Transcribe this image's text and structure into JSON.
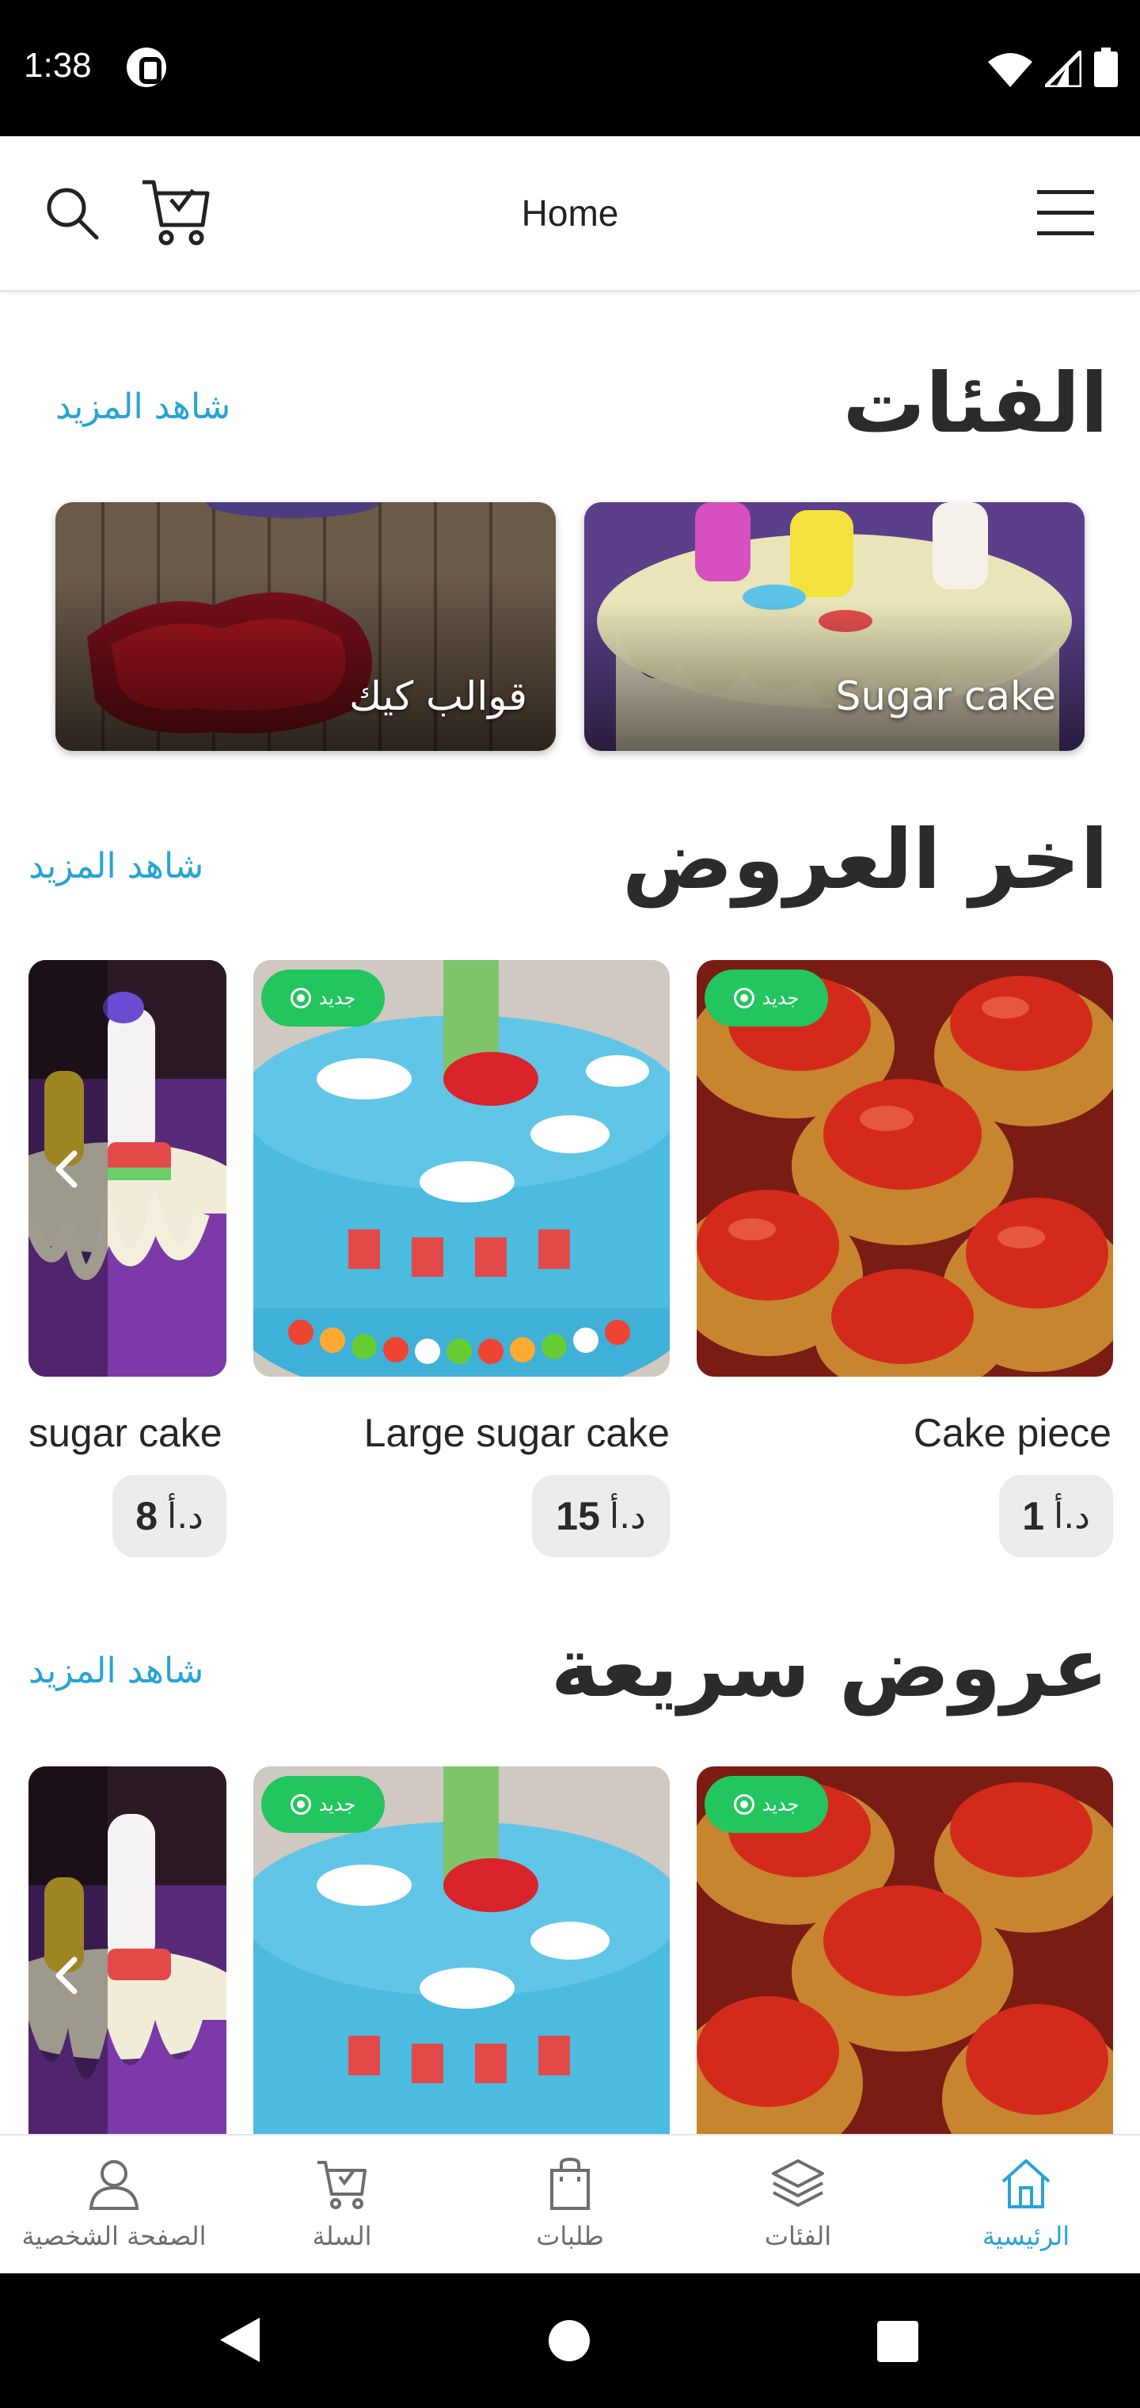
{
  "status_bar": {
    "time": "1:38"
  },
  "app_bar": {
    "title": "Home"
  },
  "categories_section": {
    "title": "الفئات",
    "see_more": "شاهد المزيد",
    "items": [
      {
        "label": "Sugar cake"
      },
      {
        "label": "قوالب كيك"
      }
    ]
  },
  "latest_offers": {
    "title": "اخر العروض",
    "see_more": "شاهد المزيد",
    "badge": "جديد",
    "products": [
      {
        "name": "Cake piece",
        "price": "1",
        "currency": "د.أ"
      },
      {
        "name": "Large sugar cake",
        "price": "15",
        "currency": "د.أ"
      },
      {
        "name": "sugar cake",
        "price": "8",
        "currency": "د.أ"
      }
    ]
  },
  "quick_offers": {
    "title": "عروض سريعة",
    "see_more": "شاهد المزيد",
    "badge": "جديد"
  },
  "bottom_nav": {
    "items": [
      {
        "label": "الصفحة الشخصية",
        "icon": "person-icon"
      },
      {
        "label": "السلة",
        "icon": "cart-icon"
      },
      {
        "label": "طلبات",
        "icon": "bag-icon"
      },
      {
        "label": "الفئات",
        "icon": "layers-icon"
      },
      {
        "label": "الرئيسية",
        "icon": "home-icon",
        "active": true
      }
    ]
  },
  "colors": {
    "accent": "#28a3d6",
    "badge_green": "#22c55e",
    "price_pill": "#ececec",
    "title_text": "#2b2b2b"
  }
}
